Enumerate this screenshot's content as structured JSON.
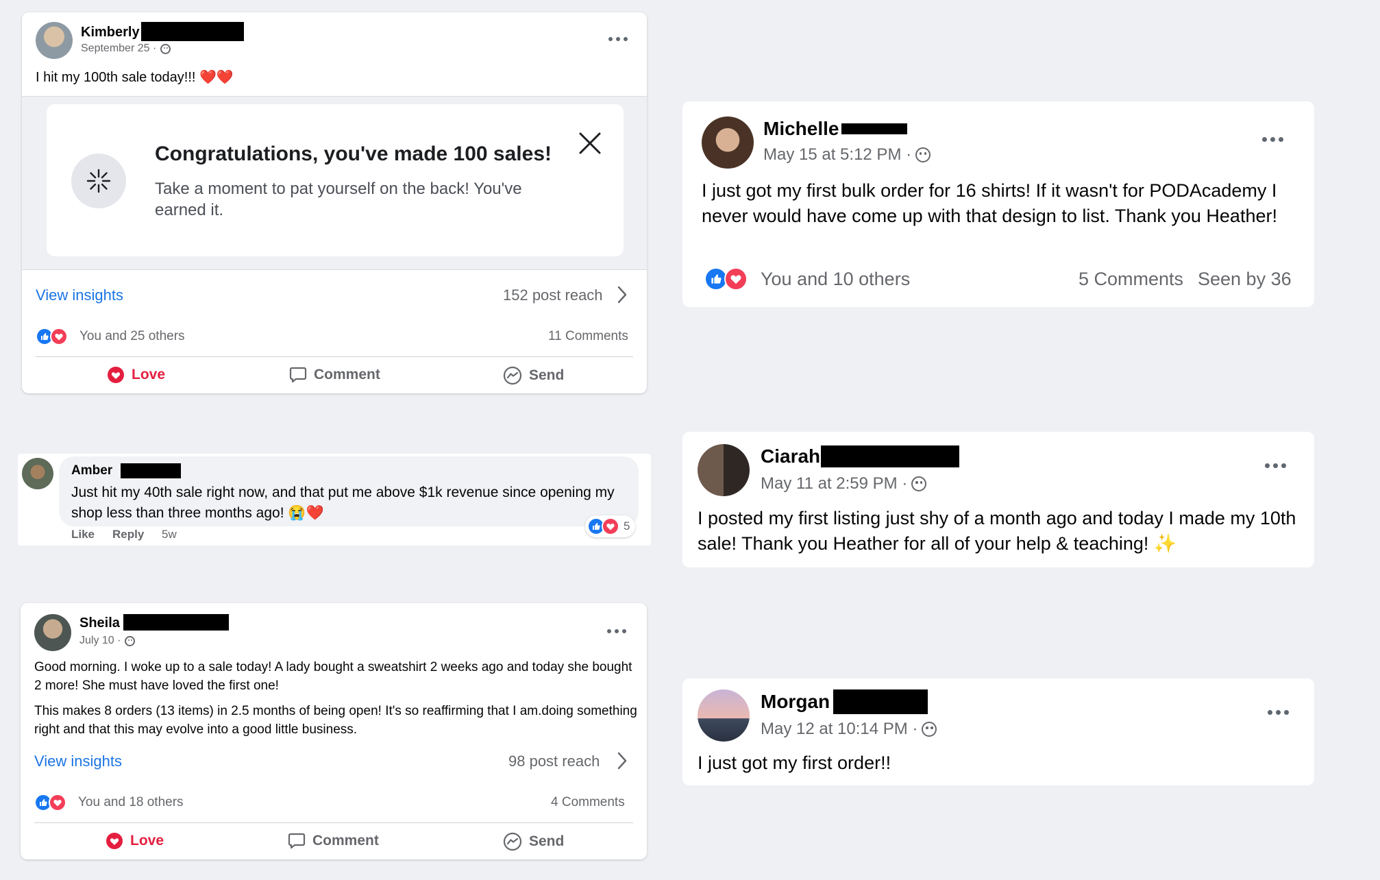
{
  "post1": {
    "author": "Kimberly",
    "date": "September 25 ·",
    "text": "I hit my 100th sale today!!! ❤️❤️",
    "banner": {
      "title": "Congratulations, you've made 100 sales!",
      "body": "Take a moment to pat yourself on the back! You've earned it."
    },
    "insights_label": "View insights",
    "reach": "152 post reach",
    "reactions": "You and 25 others",
    "comments": "11 Comments",
    "actions": [
      "Love",
      "Comment",
      "Send"
    ]
  },
  "comment1": {
    "author": "Amber",
    "text": "Just hit my 40th sale right now, and that put me above $1k revenue since opening my shop less than three months ago! 😭❤️",
    "actions": [
      "Like",
      "Reply"
    ],
    "age": "5w",
    "reaction_count": "5"
  },
  "post2": {
    "author": "Sheila",
    "date": "July 10 ·",
    "paragraph1": "Good morning. I woke up to a sale today! A lady bought a sweatshirt 2 weeks ago and today she bought 2 more! She must have loved the first one!",
    "paragraph2": "This makes 8 orders (13 items) in 2.5 months of being open! It's so reaffirming that I am.doing something right and that this may evolve into a good little business.",
    "insights_label": "View insights",
    "reach": "98 post reach",
    "reactions": "You and 18 others",
    "comments": "4 Comments",
    "actions": [
      "Love",
      "Comment",
      "Send"
    ]
  },
  "post3": {
    "author": "Michelle",
    "date": "May 15 at 5:12 PM ·",
    "text": "I just got my first bulk order for 16 shirts! If it wasn't for PODAcademy I never would have come up with that design to list. Thank you Heather!",
    "reactions": "You and 10 others",
    "comments": "5 Comments",
    "seen": "Seen by 36"
  },
  "post4": {
    "author": "Ciarah",
    "date": "May 11 at 2:59 PM ·",
    "text": "I posted my first listing just shy of a month ago and today I made my 10th sale! Thank you Heather for all of your help & teaching! ✨"
  },
  "post5": {
    "author": "Morgan",
    "date": "May 12 at 10:14 PM ·",
    "text": "I just got my first order!!"
  },
  "colors": {
    "page_bg": "#eef0f4",
    "link": "#1b74e4",
    "love": "#e41e3f",
    "like": "#1877f2",
    "muted": "#65676b"
  }
}
